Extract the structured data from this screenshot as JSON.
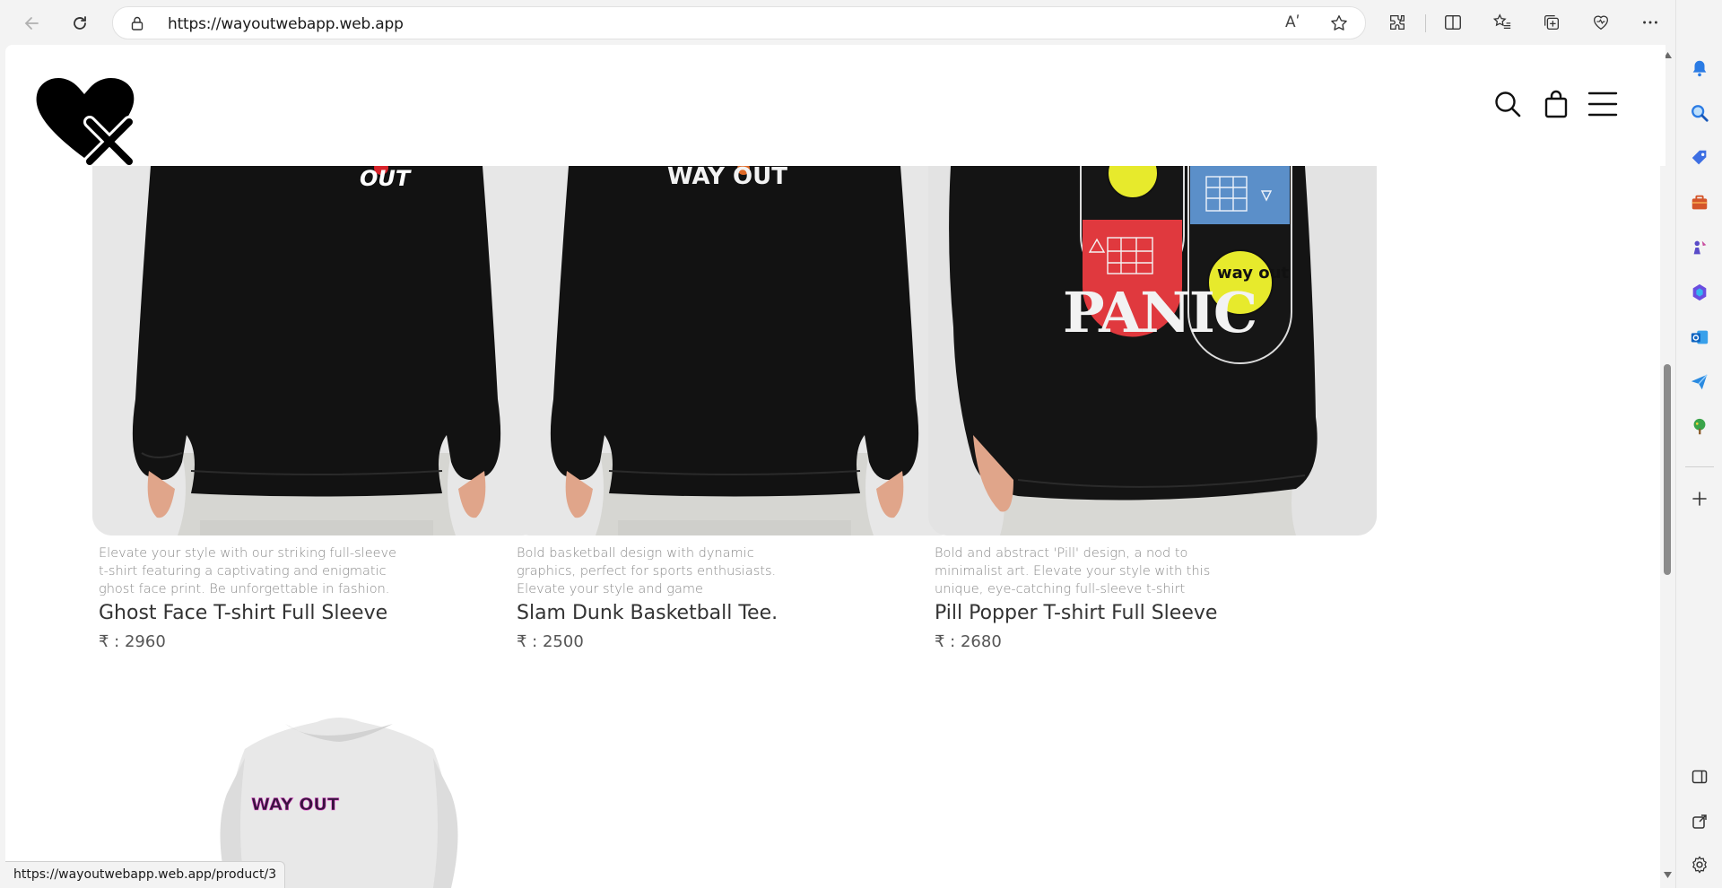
{
  "browser": {
    "url": "https://wayoutwebapp.web.app",
    "read_aloud_glyph": "Aʹ",
    "status_url": "https://wayoutwebapp.web.app/product/3"
  },
  "header": {
    "logo_name": "way-out-heart-x-logo",
    "icons": [
      "search-icon",
      "shopping-bag-icon",
      "hamburger-menu-icon"
    ]
  },
  "products": [
    {
      "desc": "Elevate your style with our striking full-sleeve t-shirt featuring a captivating and enigmatic ghost face print. Be unforgettable in fashion.",
      "name": "Ghost Face T-shirt Full Sleeve",
      "price": "₹ : 2960",
      "print_text": "OUT"
    },
    {
      "desc": "Bold basketball design with dynamic graphics, perfect for sports enthusiasts. Elevate your style and game",
      "name": "Slam Dunk Basketball Tee.",
      "price": "₹ : 2500",
      "print_text": "WAY OUT"
    },
    {
      "desc": "Bold and abstract 'Pill' design, a nod to minimalist art. Elevate your style with this unique, eye-catching full-sleeve t-shirt",
      "name": "Pill Popper T-shirt Full Sleeve",
      "price": "₹ : 2680",
      "print_text": "PANIC",
      "badge_text": "way out"
    },
    {
      "print_text": "WAY OUT"
    }
  ],
  "colors": {
    "accent_blue": "#0078d4",
    "sweater_black": "#111111",
    "pill_red": "#e0393e",
    "pill_blue": "#5b8fc9",
    "pill_yellow": "#e7ea2c"
  }
}
